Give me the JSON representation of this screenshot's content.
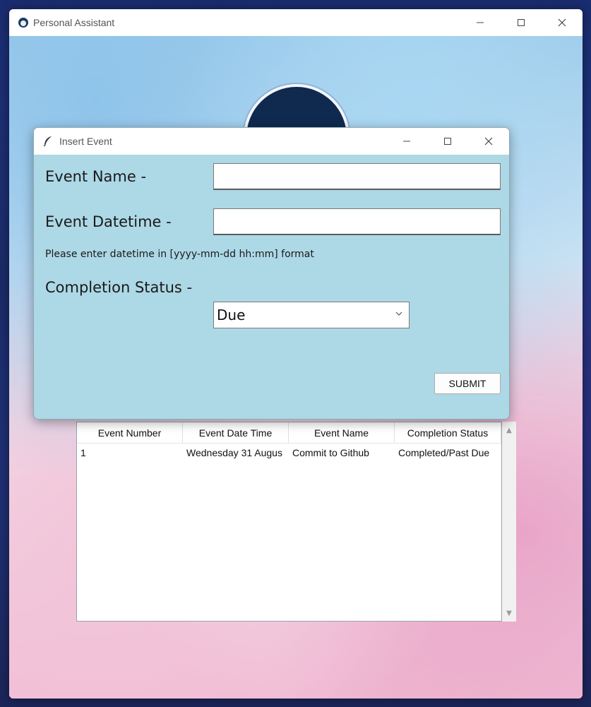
{
  "main_window": {
    "title": "Personal Assistant",
    "icon": "assistant-avatar-icon"
  },
  "dialog": {
    "title": "Insert Event",
    "icon": "feather-icon",
    "fields": {
      "event_name_label": "Event Name -",
      "event_name_value": "",
      "event_datetime_label": "Event Datetime -",
      "event_datetime_value": "",
      "hint": "Please enter datetime in [yyyy-mm-dd hh:mm] format",
      "completion_status_label": "Completion Status -",
      "completion_status_value": "Due"
    },
    "submit_label": "SUBMIT"
  },
  "table": {
    "columns": [
      "Event Number",
      "Event Date Time",
      "Event Name",
      "Completion Status"
    ],
    "rows": [
      [
        "1",
        "Wednesday 31 Augus",
        "Commit to Github",
        "Completed/Past Due"
      ]
    ]
  },
  "colors": {
    "dialog_bg": "#add8e6",
    "window_bg": "#ffffff"
  }
}
